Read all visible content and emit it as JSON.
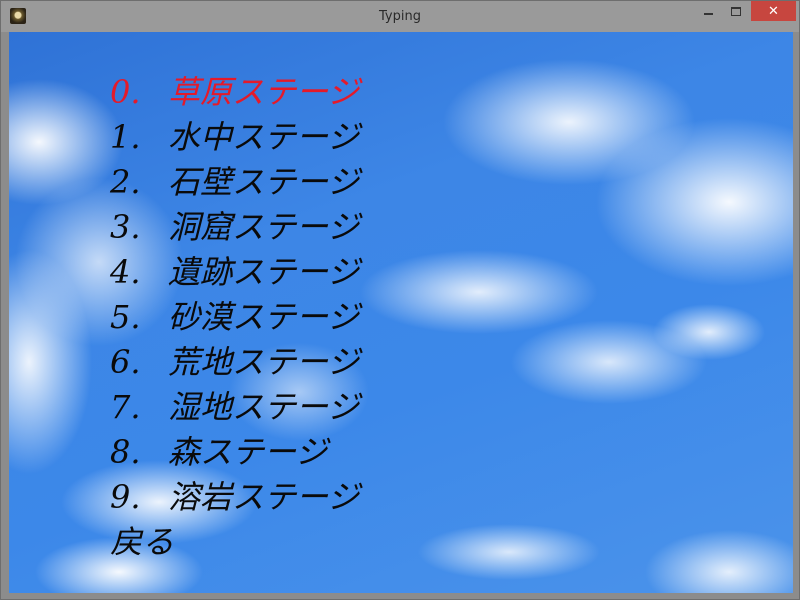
{
  "window": {
    "title": "Typing",
    "close_glyph": "✕"
  },
  "menu": {
    "selected_color": "#e41a2a",
    "items": [
      {
        "number": "0.",
        "label": "草原ステージ",
        "selected": true
      },
      {
        "number": "1.",
        "label": "水中ステージ",
        "selected": false
      },
      {
        "number": "2.",
        "label": "石壁ステージ",
        "selected": false
      },
      {
        "number": "3.",
        "label": "洞窟ステージ",
        "selected": false
      },
      {
        "number": "4.",
        "label": "遺跡ステージ",
        "selected": false
      },
      {
        "number": "5.",
        "label": "砂漠ステージ",
        "selected": false
      },
      {
        "number": "6.",
        "label": "荒地ステージ",
        "selected": false
      },
      {
        "number": "7.",
        "label": "湿地ステージ",
        "selected": false
      },
      {
        "number": "8.",
        "label": "森ステージ",
        "selected": false
      },
      {
        "number": "9.",
        "label": "溶岩ステージ",
        "selected": false
      }
    ],
    "back_label": "戻る"
  }
}
